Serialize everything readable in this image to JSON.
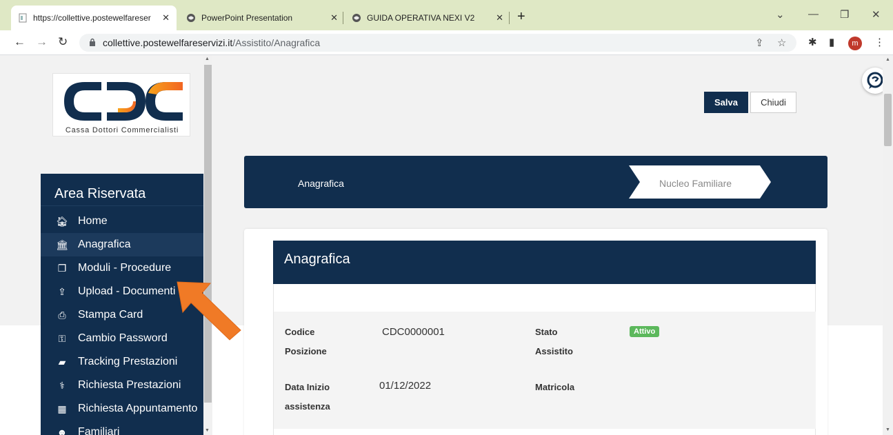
{
  "browser": {
    "tabs": [
      {
        "title": "https://collettive.postewelfareser",
        "active": true
      },
      {
        "title": "PowerPoint Presentation",
        "active": false
      },
      {
        "title": "GUIDA OPERATIVA NEXI V2",
        "active": false
      }
    ],
    "url_host": "collettive.postewelfareservizi.it",
    "url_path": "/Assistito/Anagrafica",
    "avatar_letter": "m"
  },
  "logo": {
    "text": "Cassa Dottori Commercialisti"
  },
  "sidebar": {
    "title": "Area Riservata",
    "items": [
      {
        "label": "Home",
        "icon": "home-icon"
      },
      {
        "label": "Anagrafica",
        "icon": "bank-icon"
      },
      {
        "label": "Moduli - Procedure",
        "icon": "copy-icon"
      },
      {
        "label": "Upload - Documenti",
        "icon": "upload-icon"
      },
      {
        "label": "Stampa Card",
        "icon": "print-icon"
      },
      {
        "label": "Cambio Password",
        "icon": "key-icon"
      },
      {
        "label": "Tracking Prestazioni",
        "icon": "book-icon"
      },
      {
        "label": "Richiesta Prestazioni",
        "icon": "stethoscope-icon"
      },
      {
        "label": "Richiesta Appuntamento",
        "icon": "calendar-icon"
      },
      {
        "label": "Familiari",
        "icon": "users-icon"
      }
    ]
  },
  "actions": {
    "save": "Salva",
    "close": "Chiudi"
  },
  "steps": {
    "step1": "Anagrafica",
    "step2": "Nucleo Familiare"
  },
  "card": {
    "title": "Anagrafica",
    "fields": {
      "codice_label": "Codice Posizione",
      "codice_value": "CDC0000001",
      "stato_label": "Stato Assistito",
      "stato_value": "Attivo",
      "data_label": "Data Inizio assistenza",
      "data_value": "01/12/2022",
      "matricola_label": "Matricola"
    }
  },
  "colors": {
    "navy": "#112e4e",
    "badge_green": "#5cb85c",
    "arrow_orange": "#f07a26"
  }
}
